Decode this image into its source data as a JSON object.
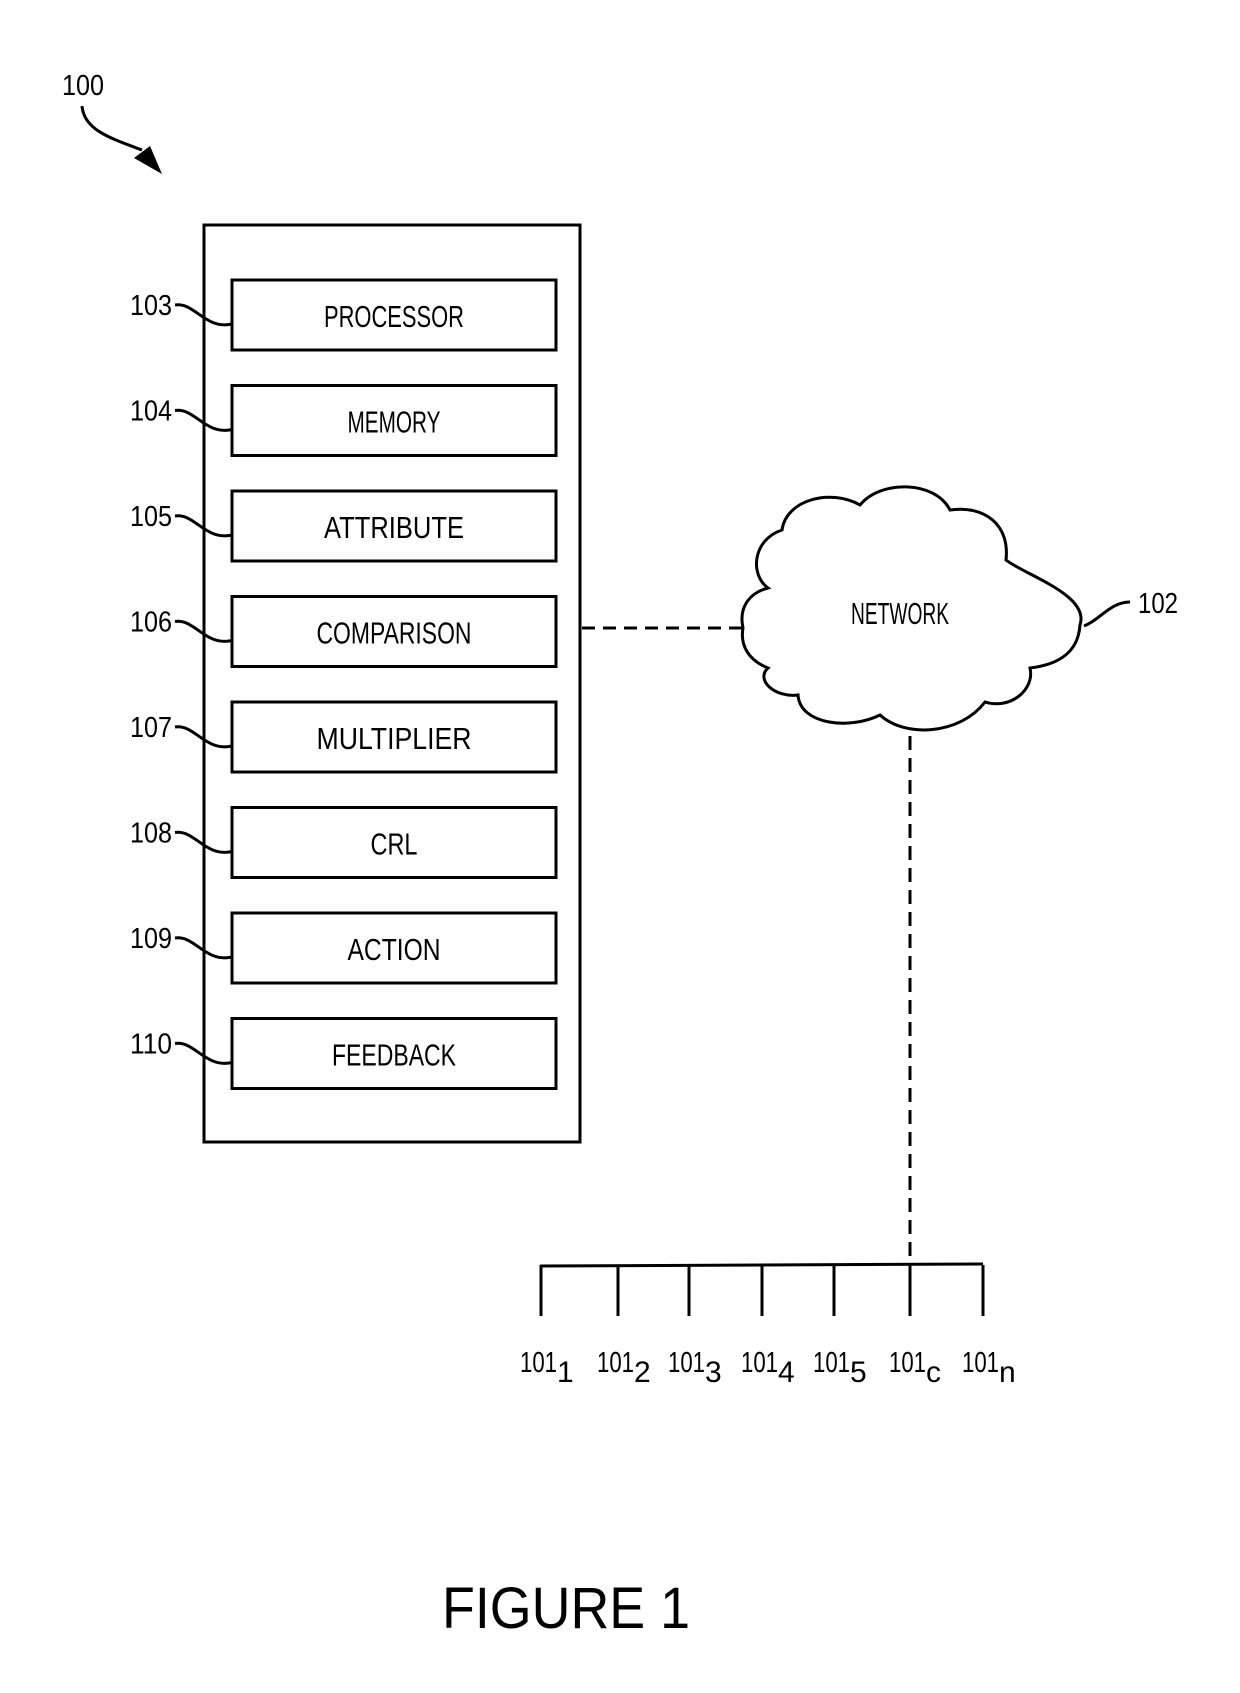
{
  "figure": {
    "caption": "FIGURE 1",
    "system_ref": "100",
    "network": {
      "label": "NETWORK",
      "ref": "102"
    },
    "components": [
      {
        "ref": "103",
        "label": "PROCESSOR"
      },
      {
        "ref": "104",
        "label": "MEMORY"
      },
      {
        "ref": "105",
        "label": "ATTRIBUTE"
      },
      {
        "ref": "106",
        "label": "COMPARISON"
      },
      {
        "ref": "107",
        "label": "MULTIPLIER"
      },
      {
        "ref": "108",
        "label": "CRL"
      },
      {
        "ref": "109",
        "label": "ACTION"
      },
      {
        "ref": "110",
        "label": "FEEDBACK"
      }
    ],
    "clients": [
      {
        "base": "101",
        "sub": "1"
      },
      {
        "base": "101",
        "sub": "2"
      },
      {
        "base": "101",
        "sub": "3"
      },
      {
        "base": "101",
        "sub": "4"
      },
      {
        "base": "101",
        "sub": "5"
      },
      {
        "base": "101",
        "sub": "c"
      },
      {
        "base": "101",
        "sub": "n"
      }
    ],
    "colors": {
      "ink": "#000000",
      "paper": "#ffffff"
    }
  }
}
